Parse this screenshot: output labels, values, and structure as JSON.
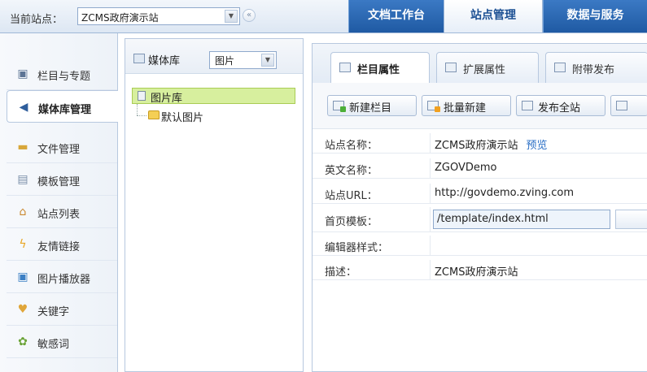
{
  "topbar": {
    "site_label": "当前站点：",
    "site_select_value": "ZCMS政府演示站",
    "tabs": [
      {
        "label": "文档工作台"
      },
      {
        "label": "站点管理"
      },
      {
        "label": "数据与服务"
      }
    ]
  },
  "sidebar": {
    "items": [
      {
        "label": "栏目与专题",
        "icon": "monitor-icon"
      },
      {
        "label": "媒体库管理",
        "icon": "speaker-icon"
      },
      {
        "label": "文件管理",
        "icon": "folder-icon"
      },
      {
        "label": "模板管理",
        "icon": "template-icon"
      },
      {
        "label": "站点列表",
        "icon": "home-icon"
      },
      {
        "label": "友情链接",
        "icon": "lightning-icon"
      },
      {
        "label": "图片播放器",
        "icon": "image-player-icon"
      },
      {
        "label": "关键字",
        "icon": "key-icon"
      },
      {
        "label": "敏感词",
        "icon": "flower-icon"
      }
    ]
  },
  "tree": {
    "header_label": "媒体库",
    "type_select_value": "图片",
    "root_label": "图片库",
    "children": [
      {
        "label": "默认图片"
      }
    ]
  },
  "detail": {
    "tabs": [
      {
        "label": "栏目属性"
      },
      {
        "label": "扩展属性"
      },
      {
        "label": "附带发布"
      }
    ],
    "toolbar": [
      {
        "label": "新建栏目"
      },
      {
        "label": "批量新建"
      },
      {
        "label": "发布全站"
      }
    ],
    "fields": {
      "site_name_label": "站点名称：",
      "site_name_value": "ZCMS政府演示站",
      "preview_link": "预览",
      "english_name_label": "英文名称：",
      "english_name_value": "ZGOVDemo",
      "site_url_label": "站点URL：",
      "site_url_value": "http://govdemo.zving.com",
      "homepage_template_label": "首页模板：",
      "homepage_template_value": "/template/index.html",
      "editor_style_label": "编辑器样式：",
      "editor_style_value": "",
      "description_label": "描述：",
      "description_value": "ZCMS政府演示站"
    }
  }
}
